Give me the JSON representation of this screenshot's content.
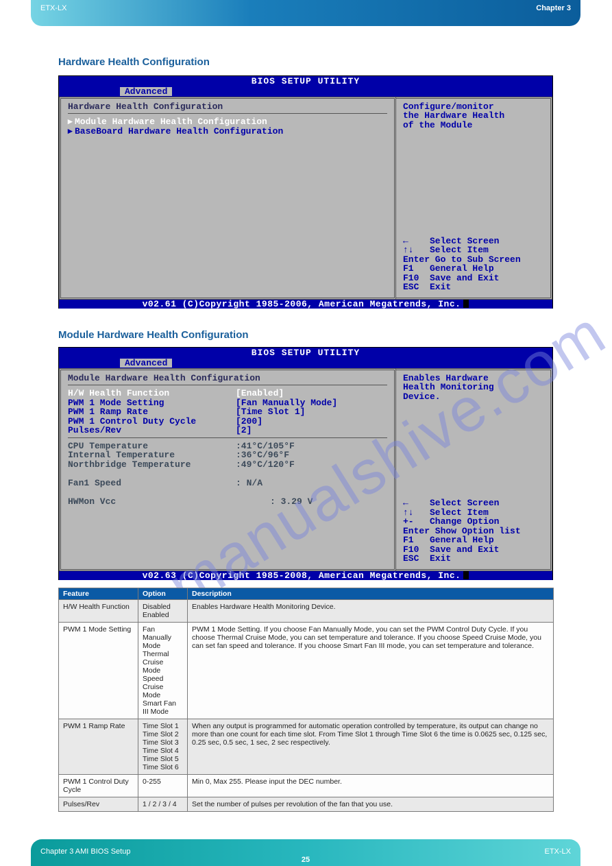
{
  "header_left": "ETX-LX",
  "header_right": "Chapter 3",
  "footer_right": "ETX-LX",
  "footer_left": "Chapter 3 AMI BIOS Setup",
  "page_number": "25",
  "watermark": "manualshive.com",
  "section_titles": {
    "s1": "Hardware Health Configuration",
    "s2": "Module Hardware Health Configuration"
  },
  "bios1": {
    "title": "BIOS SETUP UTILITY",
    "tab": "Advanced",
    "panel_title": "Hardware Health Configuration",
    "items": [
      "Module Hardware Health Configuration",
      "BaseBoard Hardware Health Configuration"
    ],
    "desc": [
      "Configure/monitor",
      "the Hardware Health",
      "of the Module"
    ],
    "help": [
      "←    Select Screen",
      "↑↓   Select Item",
      "Enter Go to Sub Screen",
      "F1   General Help",
      "F10  Save and Exit",
      "ESC  Exit"
    ],
    "copyright": "v02.61 (C)Copyright 1985-2006, American Megatrends, Inc."
  },
  "bios2": {
    "title": "BIOS SETUP UTILITY",
    "tab": "Advanced",
    "panel_title": "Module Hardware Health Configuration",
    "settings": [
      {
        "k": "H/W Health Function",
        "v": "[Enabled]",
        "sel": true
      },
      {
        "k": "PWM 1 Mode Setting",
        "v": "[Fan Manually Mode]"
      },
      {
        "k": "PWM 1 Ramp Rate",
        "v": "[Time Slot 1]"
      },
      {
        "k": "  PWM 1 Control Duty Cycle",
        "v": "[200]"
      },
      {
        "k": "Pulses/Rev",
        "v": "[2]"
      }
    ],
    "readings": [
      {
        "k": "CPU Temperature",
        "v": ":41°C/105°F"
      },
      {
        "k": "Internal  Temperature",
        "v": ":36°C/96°F"
      },
      {
        "k": "Northbridge Temperature",
        "v": ":49°C/120°F"
      },
      {
        "k": "",
        "v": ""
      },
      {
        "k": "Fan1 Speed",
        "v": ": N/A"
      },
      {
        "k": "",
        "v": ""
      },
      {
        "k": "HWMon Vcc",
        "v": ": 3.29 V"
      }
    ],
    "desc": [
      "Enables Hardware",
      "Health Monitoring",
      "Device."
    ],
    "help": [
      "←    Select Screen",
      "↑↓   Select Item",
      "+-   Change Option",
      "Enter Show Option list",
      "F1   General Help",
      "F10  Save and Exit",
      "ESC  Exit"
    ],
    "copyright": "v02.63 (C)Copyright 1985-2008, American Megatrends, Inc."
  },
  "table": {
    "headers": [
      "Feature",
      "Option",
      "Description"
    ],
    "rows": [
      {
        "f": "H/W Health Function",
        "o": "Disabled\nEnabled",
        "d": "Enables Hardware Health Monitoring Device."
      },
      {
        "f": "PWM 1 Mode Setting",
        "o": "Fan Manually Mode\nThermal Cruise Mode\nSpeed Cruise Mode\nSmart Fan III Mode",
        "d": "PWM 1 Mode Setting. If you choose Fan Manually Mode, you can set the PWM Control Duty Cycle. If you choose Thermal Cruise Mode, you can set temperature and tolerance. If you choose Speed Cruise Mode, you can set fan speed and tolerance. If you choose Smart Fan III mode, you can set temperature and tolerance."
      },
      {
        "f": "PWM 1 Ramp Rate",
        "o": "Time Slot 1\nTime Slot 2\nTime Slot 3\nTime Slot 4\nTime Slot 5\nTime Slot 6",
        "d": "When any output is programmed for automatic operation controlled by temperature, its output can change no more than one count for each time slot. From Time Slot 1 through Time Slot 6 the time is 0.0625 sec, 0.125 sec, 0.25 sec, 0.5 sec, 1 sec, 2 sec respectively."
      },
      {
        "f": "PWM 1 Control Duty Cycle",
        "o": "0-255",
        "d": "Min 0, Max 255. Please input the DEC number."
      },
      {
        "f": "Pulses/Rev",
        "o": "1 / 2 / 3 / 4",
        "d": "Set the number of pulses per revolution of the fan that you use."
      }
    ]
  }
}
